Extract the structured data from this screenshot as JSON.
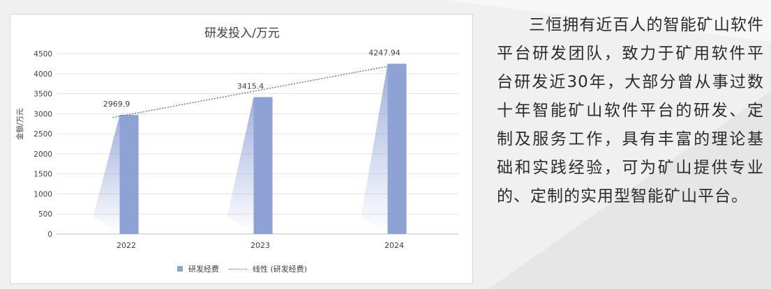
{
  "chart_data": {
    "type": "bar",
    "title": "研发投入/万元",
    "ylabel": "金额/万元",
    "xlabel": "",
    "categories": [
      "2022",
      "2023",
      "2024"
    ],
    "series": [
      {
        "name": "研发经费",
        "values": [
          2969.9,
          3415.4,
          4247.94
        ]
      }
    ],
    "data_labels": [
      "2969.9",
      "3415.4",
      "4247.94"
    ],
    "trendline": {
      "name": "线性 (研发经费)",
      "type": "linear"
    },
    "ylim": [
      0,
      4500
    ],
    "yticks": [
      "0",
      "500",
      "1000",
      "1500",
      "2000",
      "2500",
      "3000",
      "3500",
      "4000",
      "4500"
    ],
    "grid": true,
    "legend": "bottom"
  },
  "colors": {
    "bar": "#8ea2d6",
    "trend": "#4a6fb5"
  },
  "paragraph": "三恒拥有近百人的智能矿山软件平台研发团队，致力于矿用软件平台研发近30年，大部分曾从事过数十年智能矿山软件平台的研发、定制及服务工作，具有丰富的理论基础和实践经验，可为矿山提供专业的、定制的实用型智能矿山平台。"
}
